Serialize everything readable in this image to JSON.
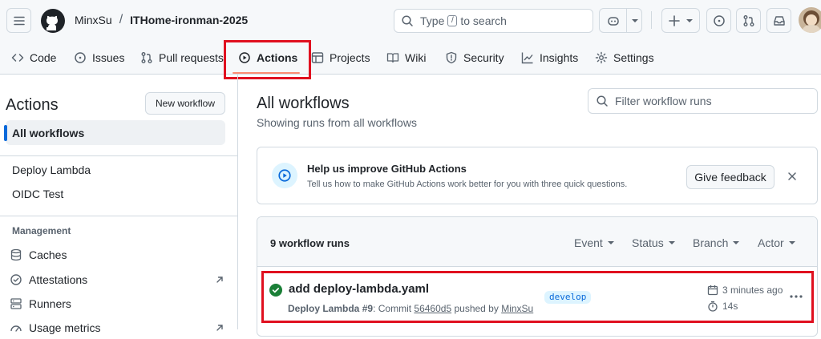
{
  "header": {
    "owner": "MinxSu",
    "separator": "/",
    "repo": "ITHome-ironman-2025",
    "search_prefix": "Type",
    "search_key": "/",
    "search_suffix": "to search"
  },
  "tabs": [
    {
      "label": "Code",
      "icon": "code-icon"
    },
    {
      "label": "Issues",
      "icon": "issue-icon"
    },
    {
      "label": "Pull requests",
      "icon": "pull-request-icon"
    },
    {
      "label": "Actions",
      "icon": "play-icon",
      "active": true
    },
    {
      "label": "Projects",
      "icon": "table-icon"
    },
    {
      "label": "Wiki",
      "icon": "book-icon"
    },
    {
      "label": "Security",
      "icon": "shield-icon"
    },
    {
      "label": "Insights",
      "icon": "graph-icon"
    },
    {
      "label": "Settings",
      "icon": "gear-icon"
    }
  ],
  "sidebar": {
    "title": "Actions",
    "new_workflow": "New workflow",
    "all_workflows": "All workflows",
    "workflows": [
      "Deploy Lambda",
      "OIDC Test"
    ],
    "management_heading": "Management",
    "management": [
      {
        "label": "Caches",
        "icon": "cache-icon"
      },
      {
        "label": "Attestations",
        "icon": "check-circle-icon"
      },
      {
        "label": "Runners",
        "icon": "server-icon"
      },
      {
        "label": "Usage metrics",
        "icon": "meter-icon"
      }
    ]
  },
  "main": {
    "title": "All workflows",
    "subtitle": "Showing runs from all workflows",
    "filter_placeholder": "Filter workflow runs",
    "banner": {
      "title": "Help us improve GitHub Actions",
      "description": "Tell us how to make GitHub Actions work better for you with three quick questions.",
      "button": "Give feedback"
    },
    "runs": {
      "count_label": "9 workflow runs",
      "filters": [
        "Event",
        "Status",
        "Branch",
        "Actor"
      ],
      "items": [
        {
          "title": "add deploy-lambda.yaml",
          "workflow": "Deploy Lambda",
          "run_number": "#9",
          "commit_prefix": ": Commit",
          "commit": "56460d5",
          "pushed_by": "pushed by",
          "actor": "MinxSu",
          "branch": "develop",
          "time": "3 minutes ago",
          "duration": "14s",
          "status": "success"
        }
      ]
    }
  },
  "colors": {
    "accent": "#0969da",
    "success": "#1a7f37",
    "highlight": "#e0101f",
    "underline": "#fd8c73"
  }
}
